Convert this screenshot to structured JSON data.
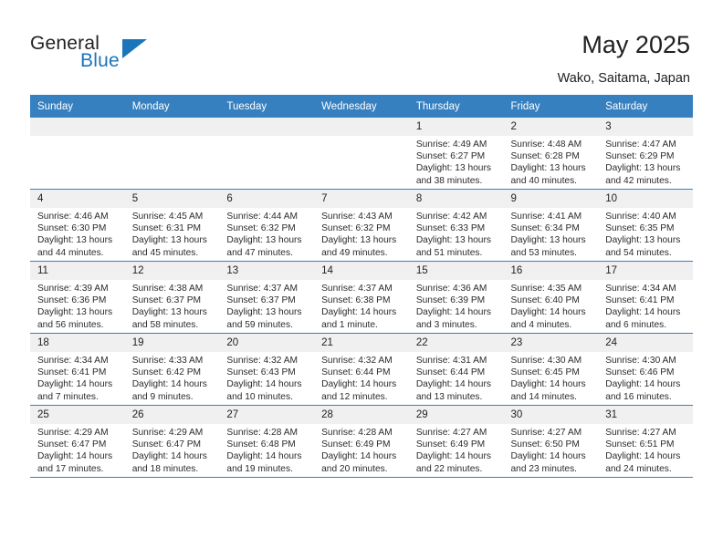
{
  "brand": {
    "name_part1": "General",
    "name_part2": "Blue",
    "accent_color": "#1b75bb"
  },
  "header": {
    "title": "May 2025",
    "subtitle": "Wako, Saitama, Japan"
  },
  "calendar": {
    "header_bg": "#3680c0",
    "daynum_bg": "#f0f0f0",
    "weekdays": [
      "Sunday",
      "Monday",
      "Tuesday",
      "Wednesday",
      "Thursday",
      "Friday",
      "Saturday"
    ],
    "labels": {
      "sunrise": "Sunrise:",
      "sunset": "Sunset:",
      "daylight": "Daylight:"
    },
    "weeks": [
      [
        {
          "day": "",
          "empty": true
        },
        {
          "day": "",
          "empty": true
        },
        {
          "day": "",
          "empty": true
        },
        {
          "day": "",
          "empty": true
        },
        {
          "day": "1",
          "sunrise": "Sunrise: 4:49 AM",
          "sunset": "Sunset: 6:27 PM",
          "daylight_line1": "Daylight: 13 hours",
          "daylight_line2": "and 38 minutes."
        },
        {
          "day": "2",
          "sunrise": "Sunrise: 4:48 AM",
          "sunset": "Sunset: 6:28 PM",
          "daylight_line1": "Daylight: 13 hours",
          "daylight_line2": "and 40 minutes."
        },
        {
          "day": "3",
          "sunrise": "Sunrise: 4:47 AM",
          "sunset": "Sunset: 6:29 PM",
          "daylight_line1": "Daylight: 13 hours",
          "daylight_line2": "and 42 minutes."
        }
      ],
      [
        {
          "day": "4",
          "sunrise": "Sunrise: 4:46 AM",
          "sunset": "Sunset: 6:30 PM",
          "daylight_line1": "Daylight: 13 hours",
          "daylight_line2": "and 44 minutes."
        },
        {
          "day": "5",
          "sunrise": "Sunrise: 4:45 AM",
          "sunset": "Sunset: 6:31 PM",
          "daylight_line1": "Daylight: 13 hours",
          "daylight_line2": "and 45 minutes."
        },
        {
          "day": "6",
          "sunrise": "Sunrise: 4:44 AM",
          "sunset": "Sunset: 6:32 PM",
          "daylight_line1": "Daylight: 13 hours",
          "daylight_line2": "and 47 minutes."
        },
        {
          "day": "7",
          "sunrise": "Sunrise: 4:43 AM",
          "sunset": "Sunset: 6:32 PM",
          "daylight_line1": "Daylight: 13 hours",
          "daylight_line2": "and 49 minutes."
        },
        {
          "day": "8",
          "sunrise": "Sunrise: 4:42 AM",
          "sunset": "Sunset: 6:33 PM",
          "daylight_line1": "Daylight: 13 hours",
          "daylight_line2": "and 51 minutes."
        },
        {
          "day": "9",
          "sunrise": "Sunrise: 4:41 AM",
          "sunset": "Sunset: 6:34 PM",
          "daylight_line1": "Daylight: 13 hours",
          "daylight_line2": "and 53 minutes."
        },
        {
          "day": "10",
          "sunrise": "Sunrise: 4:40 AM",
          "sunset": "Sunset: 6:35 PM",
          "daylight_line1": "Daylight: 13 hours",
          "daylight_line2": "and 54 minutes."
        }
      ],
      [
        {
          "day": "11",
          "sunrise": "Sunrise: 4:39 AM",
          "sunset": "Sunset: 6:36 PM",
          "daylight_line1": "Daylight: 13 hours",
          "daylight_line2": "and 56 minutes."
        },
        {
          "day": "12",
          "sunrise": "Sunrise: 4:38 AM",
          "sunset": "Sunset: 6:37 PM",
          "daylight_line1": "Daylight: 13 hours",
          "daylight_line2": "and 58 minutes."
        },
        {
          "day": "13",
          "sunrise": "Sunrise: 4:37 AM",
          "sunset": "Sunset: 6:37 PM",
          "daylight_line1": "Daylight: 13 hours",
          "daylight_line2": "and 59 minutes."
        },
        {
          "day": "14",
          "sunrise": "Sunrise: 4:37 AM",
          "sunset": "Sunset: 6:38 PM",
          "daylight_line1": "Daylight: 14 hours",
          "daylight_line2": "and 1 minute."
        },
        {
          "day": "15",
          "sunrise": "Sunrise: 4:36 AM",
          "sunset": "Sunset: 6:39 PM",
          "daylight_line1": "Daylight: 14 hours",
          "daylight_line2": "and 3 minutes."
        },
        {
          "day": "16",
          "sunrise": "Sunrise: 4:35 AM",
          "sunset": "Sunset: 6:40 PM",
          "daylight_line1": "Daylight: 14 hours",
          "daylight_line2": "and 4 minutes."
        },
        {
          "day": "17",
          "sunrise": "Sunrise: 4:34 AM",
          "sunset": "Sunset: 6:41 PM",
          "daylight_line1": "Daylight: 14 hours",
          "daylight_line2": "and 6 minutes."
        }
      ],
      [
        {
          "day": "18",
          "sunrise": "Sunrise: 4:34 AM",
          "sunset": "Sunset: 6:41 PM",
          "daylight_line1": "Daylight: 14 hours",
          "daylight_line2": "and 7 minutes."
        },
        {
          "day": "19",
          "sunrise": "Sunrise: 4:33 AM",
          "sunset": "Sunset: 6:42 PM",
          "daylight_line1": "Daylight: 14 hours",
          "daylight_line2": "and 9 minutes."
        },
        {
          "day": "20",
          "sunrise": "Sunrise: 4:32 AM",
          "sunset": "Sunset: 6:43 PM",
          "daylight_line1": "Daylight: 14 hours",
          "daylight_line2": "and 10 minutes."
        },
        {
          "day": "21",
          "sunrise": "Sunrise: 4:32 AM",
          "sunset": "Sunset: 6:44 PM",
          "daylight_line1": "Daylight: 14 hours",
          "daylight_line2": "and 12 minutes."
        },
        {
          "day": "22",
          "sunrise": "Sunrise: 4:31 AM",
          "sunset": "Sunset: 6:44 PM",
          "daylight_line1": "Daylight: 14 hours",
          "daylight_line2": "and 13 minutes."
        },
        {
          "day": "23",
          "sunrise": "Sunrise: 4:30 AM",
          "sunset": "Sunset: 6:45 PM",
          "daylight_line1": "Daylight: 14 hours",
          "daylight_line2": "and 14 minutes."
        },
        {
          "day": "24",
          "sunrise": "Sunrise: 4:30 AM",
          "sunset": "Sunset: 6:46 PM",
          "daylight_line1": "Daylight: 14 hours",
          "daylight_line2": "and 16 minutes."
        }
      ],
      [
        {
          "day": "25",
          "sunrise": "Sunrise: 4:29 AM",
          "sunset": "Sunset: 6:47 PM",
          "daylight_line1": "Daylight: 14 hours",
          "daylight_line2": "and 17 minutes."
        },
        {
          "day": "26",
          "sunrise": "Sunrise: 4:29 AM",
          "sunset": "Sunset: 6:47 PM",
          "daylight_line1": "Daylight: 14 hours",
          "daylight_line2": "and 18 minutes."
        },
        {
          "day": "27",
          "sunrise": "Sunrise: 4:28 AM",
          "sunset": "Sunset: 6:48 PM",
          "daylight_line1": "Daylight: 14 hours",
          "daylight_line2": "and 19 minutes."
        },
        {
          "day": "28",
          "sunrise": "Sunrise: 4:28 AM",
          "sunset": "Sunset: 6:49 PM",
          "daylight_line1": "Daylight: 14 hours",
          "daylight_line2": "and 20 minutes."
        },
        {
          "day": "29",
          "sunrise": "Sunrise: 4:27 AM",
          "sunset": "Sunset: 6:49 PM",
          "daylight_line1": "Daylight: 14 hours",
          "daylight_line2": "and 22 minutes."
        },
        {
          "day": "30",
          "sunrise": "Sunrise: 4:27 AM",
          "sunset": "Sunset: 6:50 PM",
          "daylight_line1": "Daylight: 14 hours",
          "daylight_line2": "and 23 minutes."
        },
        {
          "day": "31",
          "sunrise": "Sunrise: 4:27 AM",
          "sunset": "Sunset: 6:51 PM",
          "daylight_line1": "Daylight: 14 hours",
          "daylight_line2": "and 24 minutes."
        }
      ]
    ]
  }
}
